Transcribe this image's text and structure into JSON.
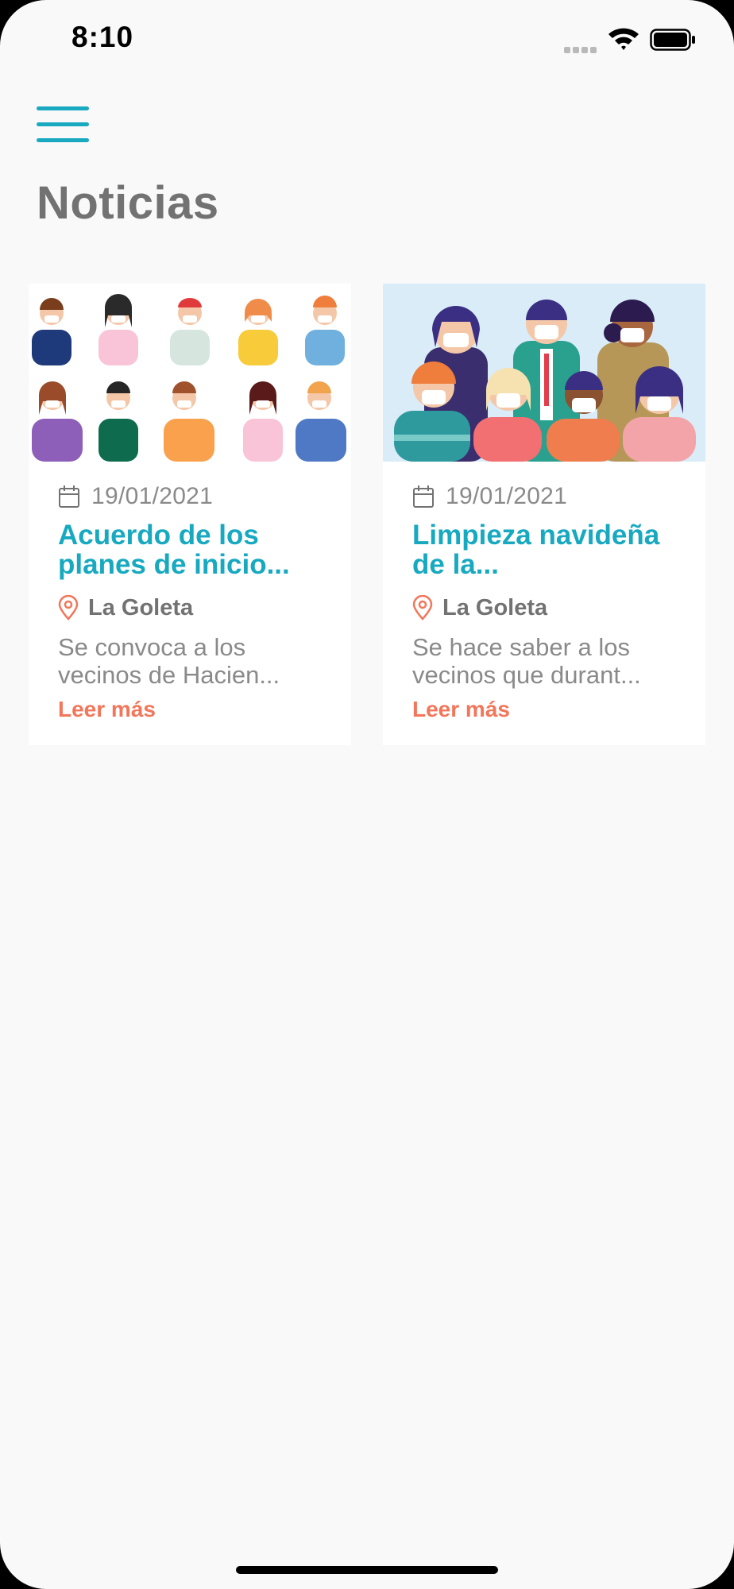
{
  "status_bar": {
    "time": "8:10"
  },
  "header": {
    "menu_icon": "hamburger-menu-icon",
    "title": "Noticias"
  },
  "news": [
    {
      "date": "19/01/2021",
      "title": "Acuerdo de los planes de inicio...",
      "location": "La Goleta",
      "excerpt": "Se convoca a los vecinos de Hacien...",
      "read_more": "Leer más"
    },
    {
      "date": "19/01/2021",
      "title": "Limpieza navideña de la...",
      "location": "La Goleta",
      "excerpt": "Se hace saber a los vecinos que durant...",
      "read_more": "Leer más"
    }
  ],
  "colors": {
    "accent": "#17a9c0",
    "link": "#f2765a",
    "title_gray": "#727272",
    "text_gray": "#8a8a8a",
    "background": "#f9f9f9"
  }
}
